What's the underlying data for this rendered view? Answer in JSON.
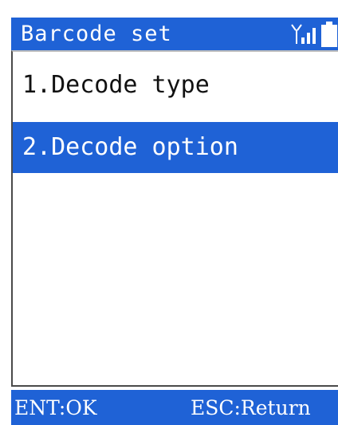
{
  "header": {
    "title": "Barcode set",
    "icons": [
      "signal-icon",
      "battery-icon"
    ]
  },
  "menu": {
    "items": [
      {
        "label": "1.Decode type",
        "selected": false
      },
      {
        "label": "2.Decode option",
        "selected": true
      }
    ]
  },
  "softkeys": {
    "left": "ENT:OK",
    "right": "ESC:Return"
  },
  "colors": {
    "accent": "#1f62d6",
    "background": "#ffffff",
    "text": "#111111",
    "inverse_text": "#ffffff"
  }
}
